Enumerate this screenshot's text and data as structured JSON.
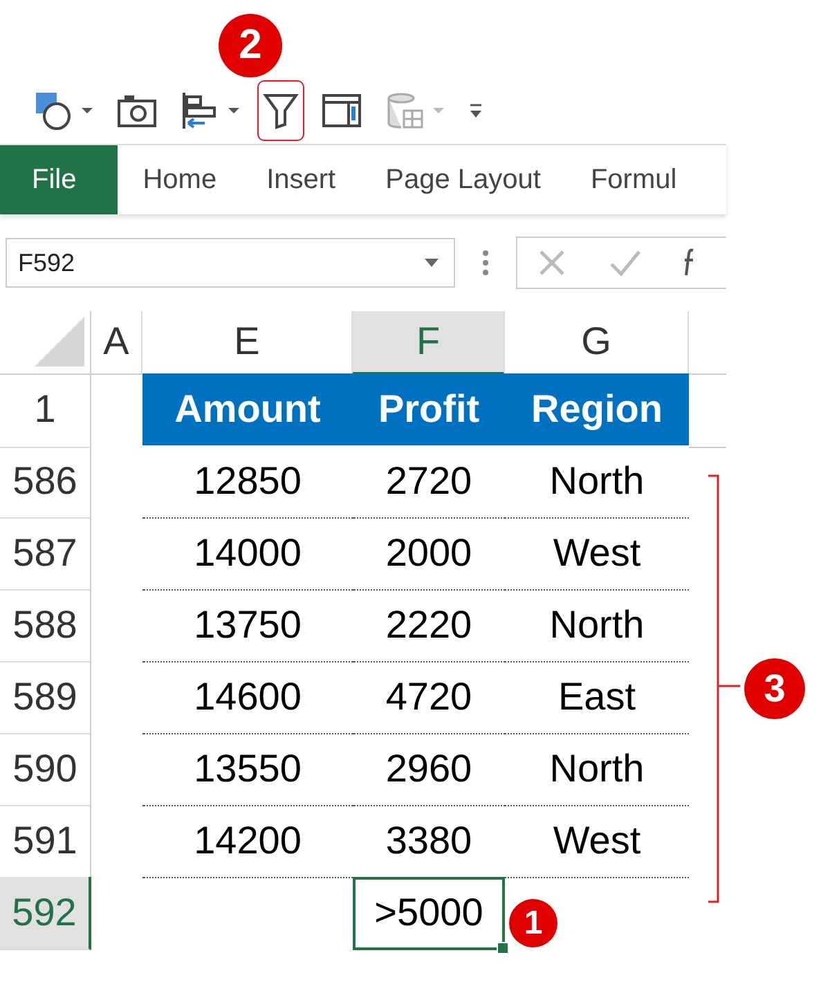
{
  "toolbar": [
    {
      "kind": "shapes",
      "dropdown": true,
      "highlighted": false
    },
    {
      "kind": "camera",
      "dropdown": false,
      "highlighted": false
    },
    {
      "kind": "align",
      "dropdown": true,
      "highlighted": false
    },
    {
      "kind": "filter",
      "dropdown": false,
      "highlighted": true
    },
    {
      "kind": "pane",
      "dropdown": false,
      "highlighted": false
    },
    {
      "kind": "database",
      "dropdown": true,
      "highlighted": false
    },
    {
      "kind": "overflow",
      "dropdown": false,
      "highlighted": false
    }
  ],
  "ribbon_tabs": [
    {
      "label": "File",
      "kind": "file"
    },
    {
      "label": "Home",
      "kind": "tab"
    },
    {
      "label": "Insert",
      "kind": "tab"
    },
    {
      "label": "Page Layout",
      "kind": "tab"
    },
    {
      "label": "Formul",
      "kind": "tab"
    }
  ],
  "name_box": {
    "value": "F592"
  },
  "columns": [
    {
      "label": "A",
      "selected": false
    },
    {
      "label": "E",
      "selected": false
    },
    {
      "label": "F",
      "selected": true
    },
    {
      "label": "G",
      "selected": false
    }
  ],
  "header_row": {
    "number": "1",
    "cells": [
      "Amount",
      "Profit",
      "Region"
    ]
  },
  "rows": [
    {
      "number": "586",
      "selected": false,
      "cells": [
        "12850",
        "2720",
        "North"
      ]
    },
    {
      "number": "587",
      "selected": false,
      "cells": [
        "14000",
        "2000",
        "West"
      ]
    },
    {
      "number": "588",
      "selected": false,
      "cells": [
        "13750",
        "2220",
        "North"
      ]
    },
    {
      "number": "589",
      "selected": false,
      "cells": [
        "14600",
        "4720",
        "East"
      ]
    },
    {
      "number": "590",
      "selected": false,
      "cells": [
        "13550",
        "2960",
        "North"
      ]
    },
    {
      "number": "591",
      "selected": false,
      "cells": [
        "14200",
        "3380",
        "West"
      ]
    }
  ],
  "criteria_row": {
    "number": "592",
    "selected": true,
    "value": ">5000",
    "active": true
  },
  "callouts": [
    {
      "number": "2",
      "kind": "toolbar"
    },
    {
      "number": "1",
      "kind": "cell"
    },
    {
      "number": "3",
      "kind": "range"
    }
  ]
}
